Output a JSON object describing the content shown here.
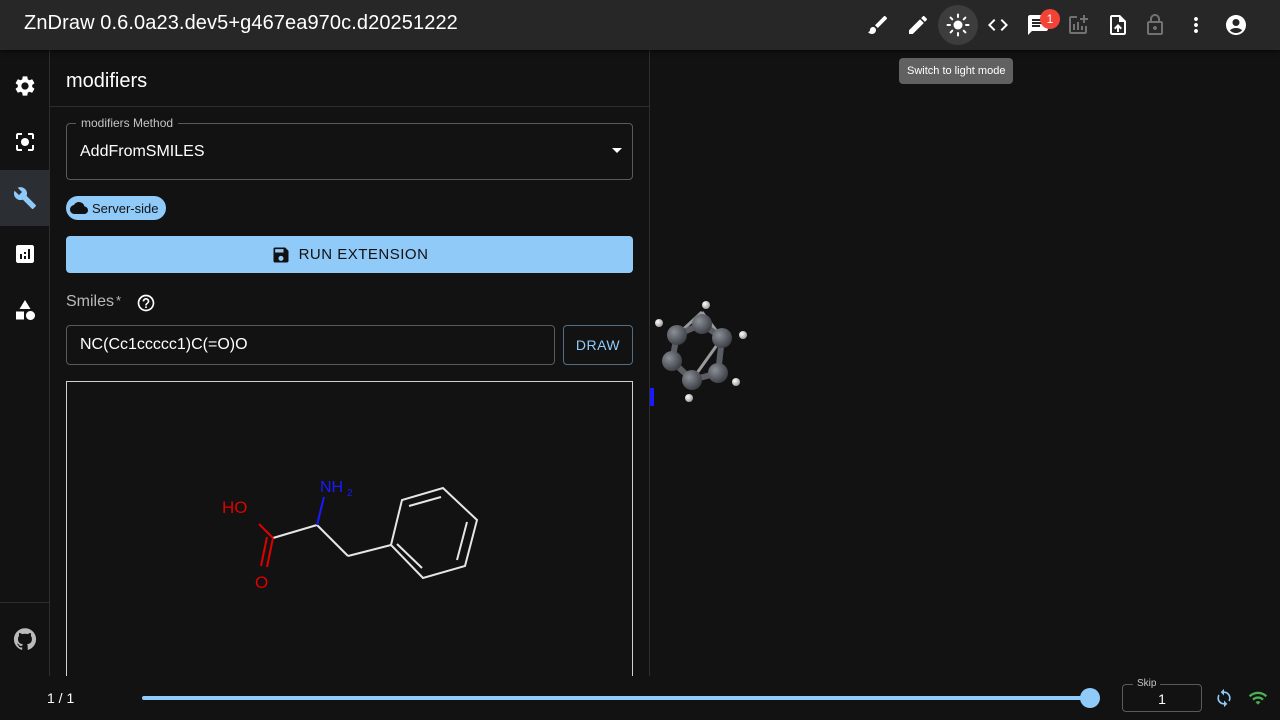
{
  "app": {
    "title": "ZnDraw 0.6.0a23.dev5+g467ea970c.d20251222",
    "tooltip": "Switch to light mode",
    "chat_badge_count": "1"
  },
  "toolbar": {
    "icons": [
      "brush-icon",
      "pencil-icon",
      "light-mode-icon",
      "code-icon",
      "chat-icon",
      "add-chart-icon",
      "upload-file-icon",
      "lock-icon",
      "more-vert-icon",
      "account-icon"
    ]
  },
  "rail": {
    "items": [
      "settings-icon",
      "selection-icon",
      "modifiers-icon",
      "analysis-icon",
      "geometry-icon"
    ],
    "active": "modifiers-icon",
    "bottom": "github-icon"
  },
  "panel": {
    "title": "modifiers",
    "method_label": "modifiers Method",
    "method_value": "AddFromSMILES",
    "chip_label": "Server-side",
    "run_label": "RUN EXTENSION",
    "field_label": "Smiles",
    "field_required": "*",
    "smiles_value": "NC(Cc1ccccc1)C(=O)O",
    "draw_label": "DRAW",
    "molecule": {
      "atom_labels": {
        "ho": "HO",
        "o": "O",
        "n": "NH",
        "n_sub": "2"
      },
      "colors": {
        "oxygen": "#e00000",
        "nitrogen": "#1a1aff",
        "bond": "#e6e6e6"
      }
    }
  },
  "footer": {
    "frame_counter": "1 / 1",
    "slider_value": 1.0,
    "skip_label": "Skip",
    "skip_value": "1"
  },
  "colors": {
    "accent": "#90caf9",
    "badge": "#f44336",
    "wifi": "#4caf50",
    "appbar": "#272727",
    "background": "#121212"
  }
}
